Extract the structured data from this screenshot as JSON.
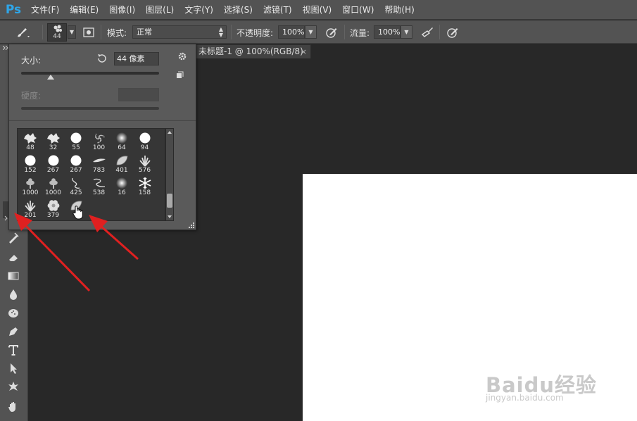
{
  "app": {
    "logo": "Ps"
  },
  "menu": [
    "文件(F)",
    "编辑(E)",
    "图像(I)",
    "图层(L)",
    "文字(Y)",
    "选择(S)",
    "滤镜(T)",
    "视图(V)",
    "窗口(W)",
    "帮助(H)"
  ],
  "options_bar": {
    "brush_size": "44",
    "mode_label": "模式:",
    "mode_value": "正常",
    "opacity_label": "不透明度:",
    "opacity_value": "100%",
    "flow_label": "流量:",
    "flow_value": "100%"
  },
  "document_tab": {
    "title": "未标题-1 @ 100%(RGB/8)",
    "close": "×"
  },
  "brush_panel": {
    "size_label": "大小:",
    "size_value": "44 像素",
    "hardness_label": "硬度:",
    "presets": [
      [
        "48",
        "32",
        "55",
        "100",
        "64",
        "94"
      ],
      [
        "152",
        "267",
        "267",
        "783",
        "401",
        "576"
      ],
      [
        "1000",
        "1000",
        "425",
        "538",
        "16",
        "158"
      ],
      [
        "201",
        "379",
        "1"
      ]
    ]
  },
  "watermark": {
    "text": "Baidu经验",
    "sub": "jingyan.baidu.com"
  },
  "colors": {
    "accent": "#2fa6e8",
    "arrow": "#e02020",
    "canvas": "#ffffff",
    "workspace": "#282828"
  }
}
